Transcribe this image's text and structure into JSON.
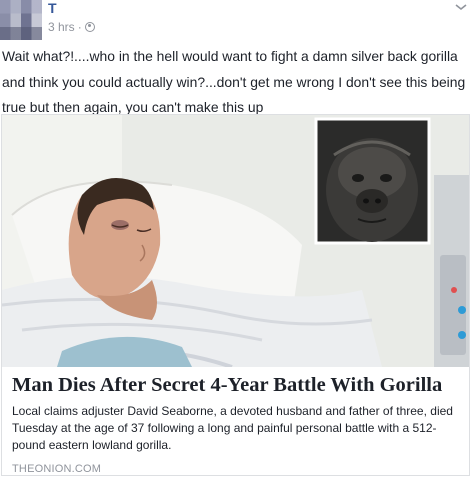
{
  "post": {
    "author": "T",
    "timestamp": "3 hrs",
    "separator": "·",
    "privacy_icon": "globe-icon",
    "menu_icon": "chevron-down-icon",
    "text": "Wait what?!....who in the hell would want to fight a damn silver back gorilla and think you could actually win?...don't get me wrong I don't see this being true but then again, you can't make this up"
  },
  "link_card": {
    "title": "Man Dies After Secret 4-Year Battle With Gorilla",
    "description": "Local claims adjuster David Seaborne, a devoted husband and father of three, died Tuesday at the age of 37 following a long and painful personal battle with a 512-pound eastern lowland gorilla.",
    "domain": "THEONION.COM"
  },
  "colors": {
    "author_link": "#365899",
    "meta_gray": "#90949c",
    "text": "#1d2129",
    "border": "#dddfe2"
  }
}
